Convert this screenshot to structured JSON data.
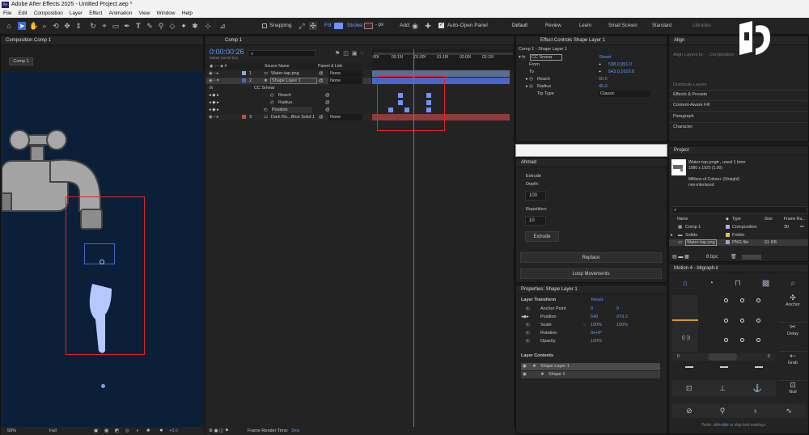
{
  "app": {
    "title": "Adobe After Effects 2025 - Untitled Project.aep *",
    "badge": "Ae"
  },
  "menu": [
    "File",
    "Edit",
    "Composition",
    "Layer",
    "Effect",
    "Animation",
    "View",
    "Window",
    "Help"
  ],
  "toolbar": {
    "snapping": "Snapping",
    "fill": "Fill:",
    "stroke": "Stroke:",
    "stroke_px": "- px",
    "add": "Add:",
    "auto_open": "Auto-Open Panel"
  },
  "workspaces": [
    "Default",
    "Review",
    "Learn",
    "Small Screen",
    "Standard",
    "Libraries"
  ],
  "comp_panel": {
    "tab": "Composition Comp 1",
    "chip": "Comp 1",
    "zoom": "50%",
    "quality": "Full",
    "exposure": "+0.0"
  },
  "timeline": {
    "tab": "Comp 1",
    "timecode": "0:00:00:26",
    "fps": "00026 (30.00 fps)",
    "col_source": "Source Name",
    "col_parent": "Parent & Link",
    "ruler": [
      ":00f",
      "00:15f",
      "01:00f",
      "01:15f",
      "02:00f",
      "02:15f"
    ],
    "layers": [
      {
        "num": "1",
        "name": "Water-tap.png",
        "parent": "None",
        "color": "#9aa6c0"
      },
      {
        "num": "2",
        "name": "Shape Layer 1",
        "parent": "None",
        "color": "#4a66c8"
      },
      {
        "num": "3",
        "name": "Dark Ro...Blue Solid 1",
        "parent": "None",
        "color": "#c04a4a"
      }
    ],
    "effect": "CC Smear",
    "props": [
      "Reach",
      "Radius",
      "Position"
    ],
    "fx": "fx",
    "render_label": "Frame Render Time:",
    "render_value": "3ms"
  },
  "effect_controls": {
    "tab": "Effect Controls Shape Layer 1",
    "layer": "Comp 1 - Shape Layer 1",
    "effect": "CC Smear",
    "reset": "Reset",
    "rows": [
      {
        "label": "From",
        "value": "538.0,951.0"
      },
      {
        "label": "To",
        "value": "543.0,1619.0"
      },
      {
        "label": "Reach",
        "value": "50.0"
      },
      {
        "label": "Radius",
        "value": "45.0"
      },
      {
        "label": "Tip Type",
        "value": "Classic"
      }
    ]
  },
  "ahmad": {
    "title": "Ahmad",
    "extrude": "Extrude",
    "depth_label": "Depth:",
    "depth": "100",
    "rep_label": "Repetition:",
    "rep": "10",
    "extrude_btn": "Extrude",
    "replace_btn": "Replace",
    "loop_btn": "Loop Movements"
  },
  "properties": {
    "title": "Properties: Shape Layer 1",
    "section": "Layer Transform",
    "reset": "Reset",
    "rows": [
      {
        "label": "Anchor Point",
        "v1": "0",
        "v2": "0"
      },
      {
        "label": "Position",
        "v1": "540",
        "v2": "973.3"
      },
      {
        "label": "Scale",
        "v1": "100%",
        "v2": "100%"
      },
      {
        "label": "Rotation",
        "v1": "0x+0°",
        "v2": ""
      },
      {
        "label": "Opacity",
        "v1": "100%",
        "v2": ""
      }
    ],
    "contents": "Layer Contents",
    "content_items": [
      "Shape Layer 1",
      "Shape 1"
    ]
  },
  "right_panels": {
    "align": "Align",
    "align_to": "Align Layers to:",
    "align_to_value": "Composition",
    "items": [
      "Distribute Layers",
      "Effects & Presets",
      "Content-Aware Fill",
      "Paragraph",
      "Character"
    ]
  },
  "project": {
    "title": "Project",
    "file": "Water-tap.png▾ , used 1 time",
    "dims": "1080 x 1920 (1.00)",
    "colors": "Millions of Colors+ (Straight)",
    "interlace": "non-interlaced",
    "cols": [
      "Name",
      "Type",
      "Size",
      "Frame Ra..."
    ],
    "rows": [
      {
        "name": "Comp 1",
        "type": "Composition",
        "size": "",
        "fps": "30"
      },
      {
        "name": "Solids",
        "type": "Folder",
        "size": "",
        "fps": ""
      },
      {
        "name": "Water-tap.png",
        "type": "PNG file",
        "size": "61 KB",
        "fps": ""
      }
    ],
    "bpc": "8 bpc"
  },
  "motion": {
    "title": "Motion 4 - bitgraph.ir",
    "side": [
      "Anchor",
      "Delay",
      "Grab",
      "Null"
    ],
    "hint_pre": "Tools:",
    "hint_key": "ctrl+click",
    "hint_post": "to skip tool overlays"
  }
}
